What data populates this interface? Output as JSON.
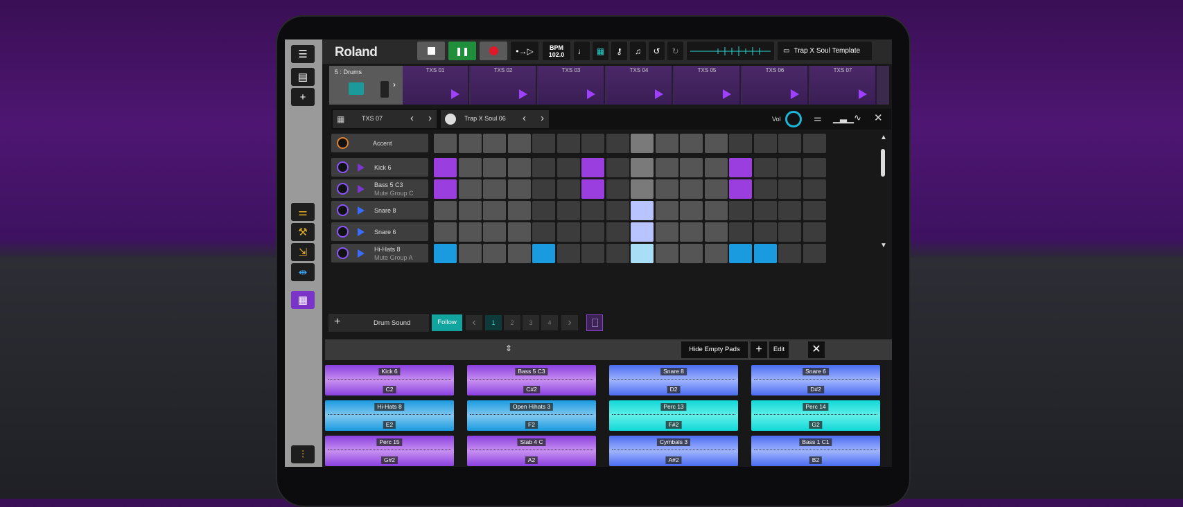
{
  "app": {
    "logo": "Roland",
    "bpm_label": "BPM",
    "bpm_value": "102.0",
    "project": "Trap X Soul Template"
  },
  "track": {
    "name": "5 : Drums"
  },
  "clips": [
    "TXS 01",
    "TXS 02",
    "TXS 03",
    "TXS 04",
    "TXS 05",
    "TXS 06",
    "TXS 07"
  ],
  "control": {
    "pattern": "TXS 07",
    "kit": "Trap X Soul 06",
    "vol_label": "Vol"
  },
  "rows": [
    {
      "name": "Accent",
      "sub": ""
    },
    {
      "name": "Kick 6",
      "sub": ""
    },
    {
      "name": "Bass 5 C3",
      "sub": "Mute Group C"
    },
    {
      "name": "Snare 8",
      "sub": ""
    },
    {
      "name": "Snare 6",
      "sub": ""
    },
    {
      "name": "Hi-Hats 8",
      "sub": "Mute Group A"
    }
  ],
  "grid": [
    [
      0,
      0,
      0,
      0,
      0,
      0,
      0,
      0,
      0,
      0,
      0,
      0,
      0,
      0,
      0,
      0
    ],
    [
      1,
      0,
      0,
      0,
      0,
      0,
      1,
      0,
      0,
      0,
      0,
      0,
      1,
      0,
      0,
      0
    ],
    [
      1,
      0,
      0,
      0,
      0,
      0,
      1,
      0,
      0,
      0,
      0,
      0,
      1,
      0,
      0,
      0
    ],
    [
      0,
      0,
      0,
      0,
      0,
      0,
      0,
      0,
      1,
      0,
      0,
      0,
      0,
      0,
      0,
      0
    ],
    [
      0,
      0,
      0,
      0,
      0,
      0,
      0,
      0,
      1,
      0,
      0,
      0,
      0,
      0,
      0,
      0
    ],
    [
      1,
      0,
      0,
      0,
      1,
      0,
      0,
      0,
      1,
      0,
      0,
      0,
      1,
      1,
      0,
      0
    ]
  ],
  "pagebar": {
    "add_label": "Drum Sound",
    "follow": "Follow",
    "pages": [
      "1",
      "2",
      "3",
      "4"
    ]
  },
  "padhead": {
    "hide_empty": "Hide Empty Pads",
    "edit": "Edit"
  },
  "pads": [
    {
      "name": "Kick 6",
      "key": "C2",
      "color": "purple"
    },
    {
      "name": "Bass 5 C3",
      "key": "C#2",
      "color": "purple"
    },
    {
      "name": "Snare 8",
      "key": "D2",
      "color": "blue"
    },
    {
      "name": "Snare 6",
      "key": "D#2",
      "color": "blue"
    },
    {
      "name": "Hi-Hats 8",
      "key": "E2",
      "color": "sky"
    },
    {
      "name": "Open Hihats 3",
      "key": "F2",
      "color": "sky"
    },
    {
      "name": "Perc 13",
      "key": "F#2",
      "color": "cyan"
    },
    {
      "name": "Perc 14",
      "key": "G2",
      "color": "cyan"
    },
    {
      "name": "Perc 15",
      "key": "G#2",
      "color": "purple"
    },
    {
      "name": "Stab 4 C",
      "key": "A2",
      "color": "purple"
    },
    {
      "name": "Cymbals 3",
      "key": "A#2",
      "color": "blue"
    },
    {
      "name": "Bass 1 C1",
      "key": "B2",
      "color": "blue"
    }
  ],
  "colors": {
    "accent": "#8a3fd6",
    "play_green": "#1f8f3c",
    "record": "#e0182a",
    "teal": "#12a5a0"
  }
}
